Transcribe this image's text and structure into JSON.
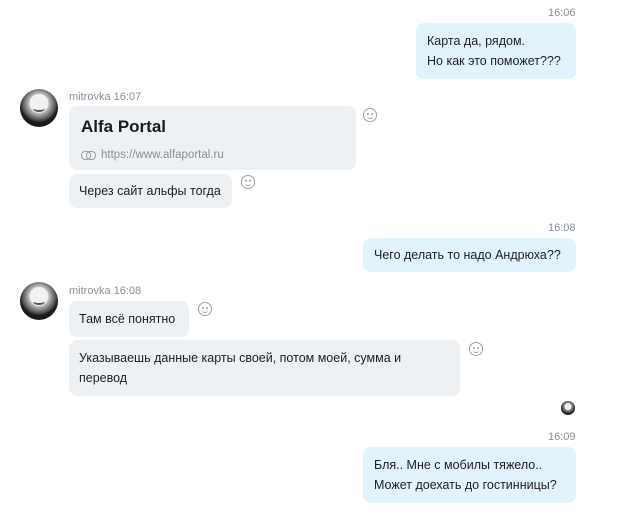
{
  "messages": {
    "m1": {
      "time": "16:06",
      "lines": [
        "Карта да, рядом.",
        "Но как это поможет???"
      ]
    },
    "group1": {
      "sender": "mitrovka 16:07",
      "link": {
        "title": "Alfa Portal",
        "url": "https://www.alfaportal.ru"
      },
      "text": "Через сайт альфы тогда"
    },
    "m2": {
      "time": "16:08",
      "text": "Чего делать то надо Андрюха??"
    },
    "group2": {
      "sender": "mitrovka 16:08",
      "text1": "Там всё понятно",
      "text2_lines": [
        "Указываешь данные карты своей, потом моей, сумма и",
        "перевод"
      ]
    },
    "m3": {
      "time": "16:09",
      "lines": [
        "Бля.. Мне с мобилы тяжело..",
        "Может доехать до гостинницы?"
      ]
    }
  },
  "icons": {
    "avatar": "user-avatar",
    "emoji": "smiley-icon",
    "link": "chain-link-icon",
    "read_receipt": "read-avatar-icon"
  }
}
